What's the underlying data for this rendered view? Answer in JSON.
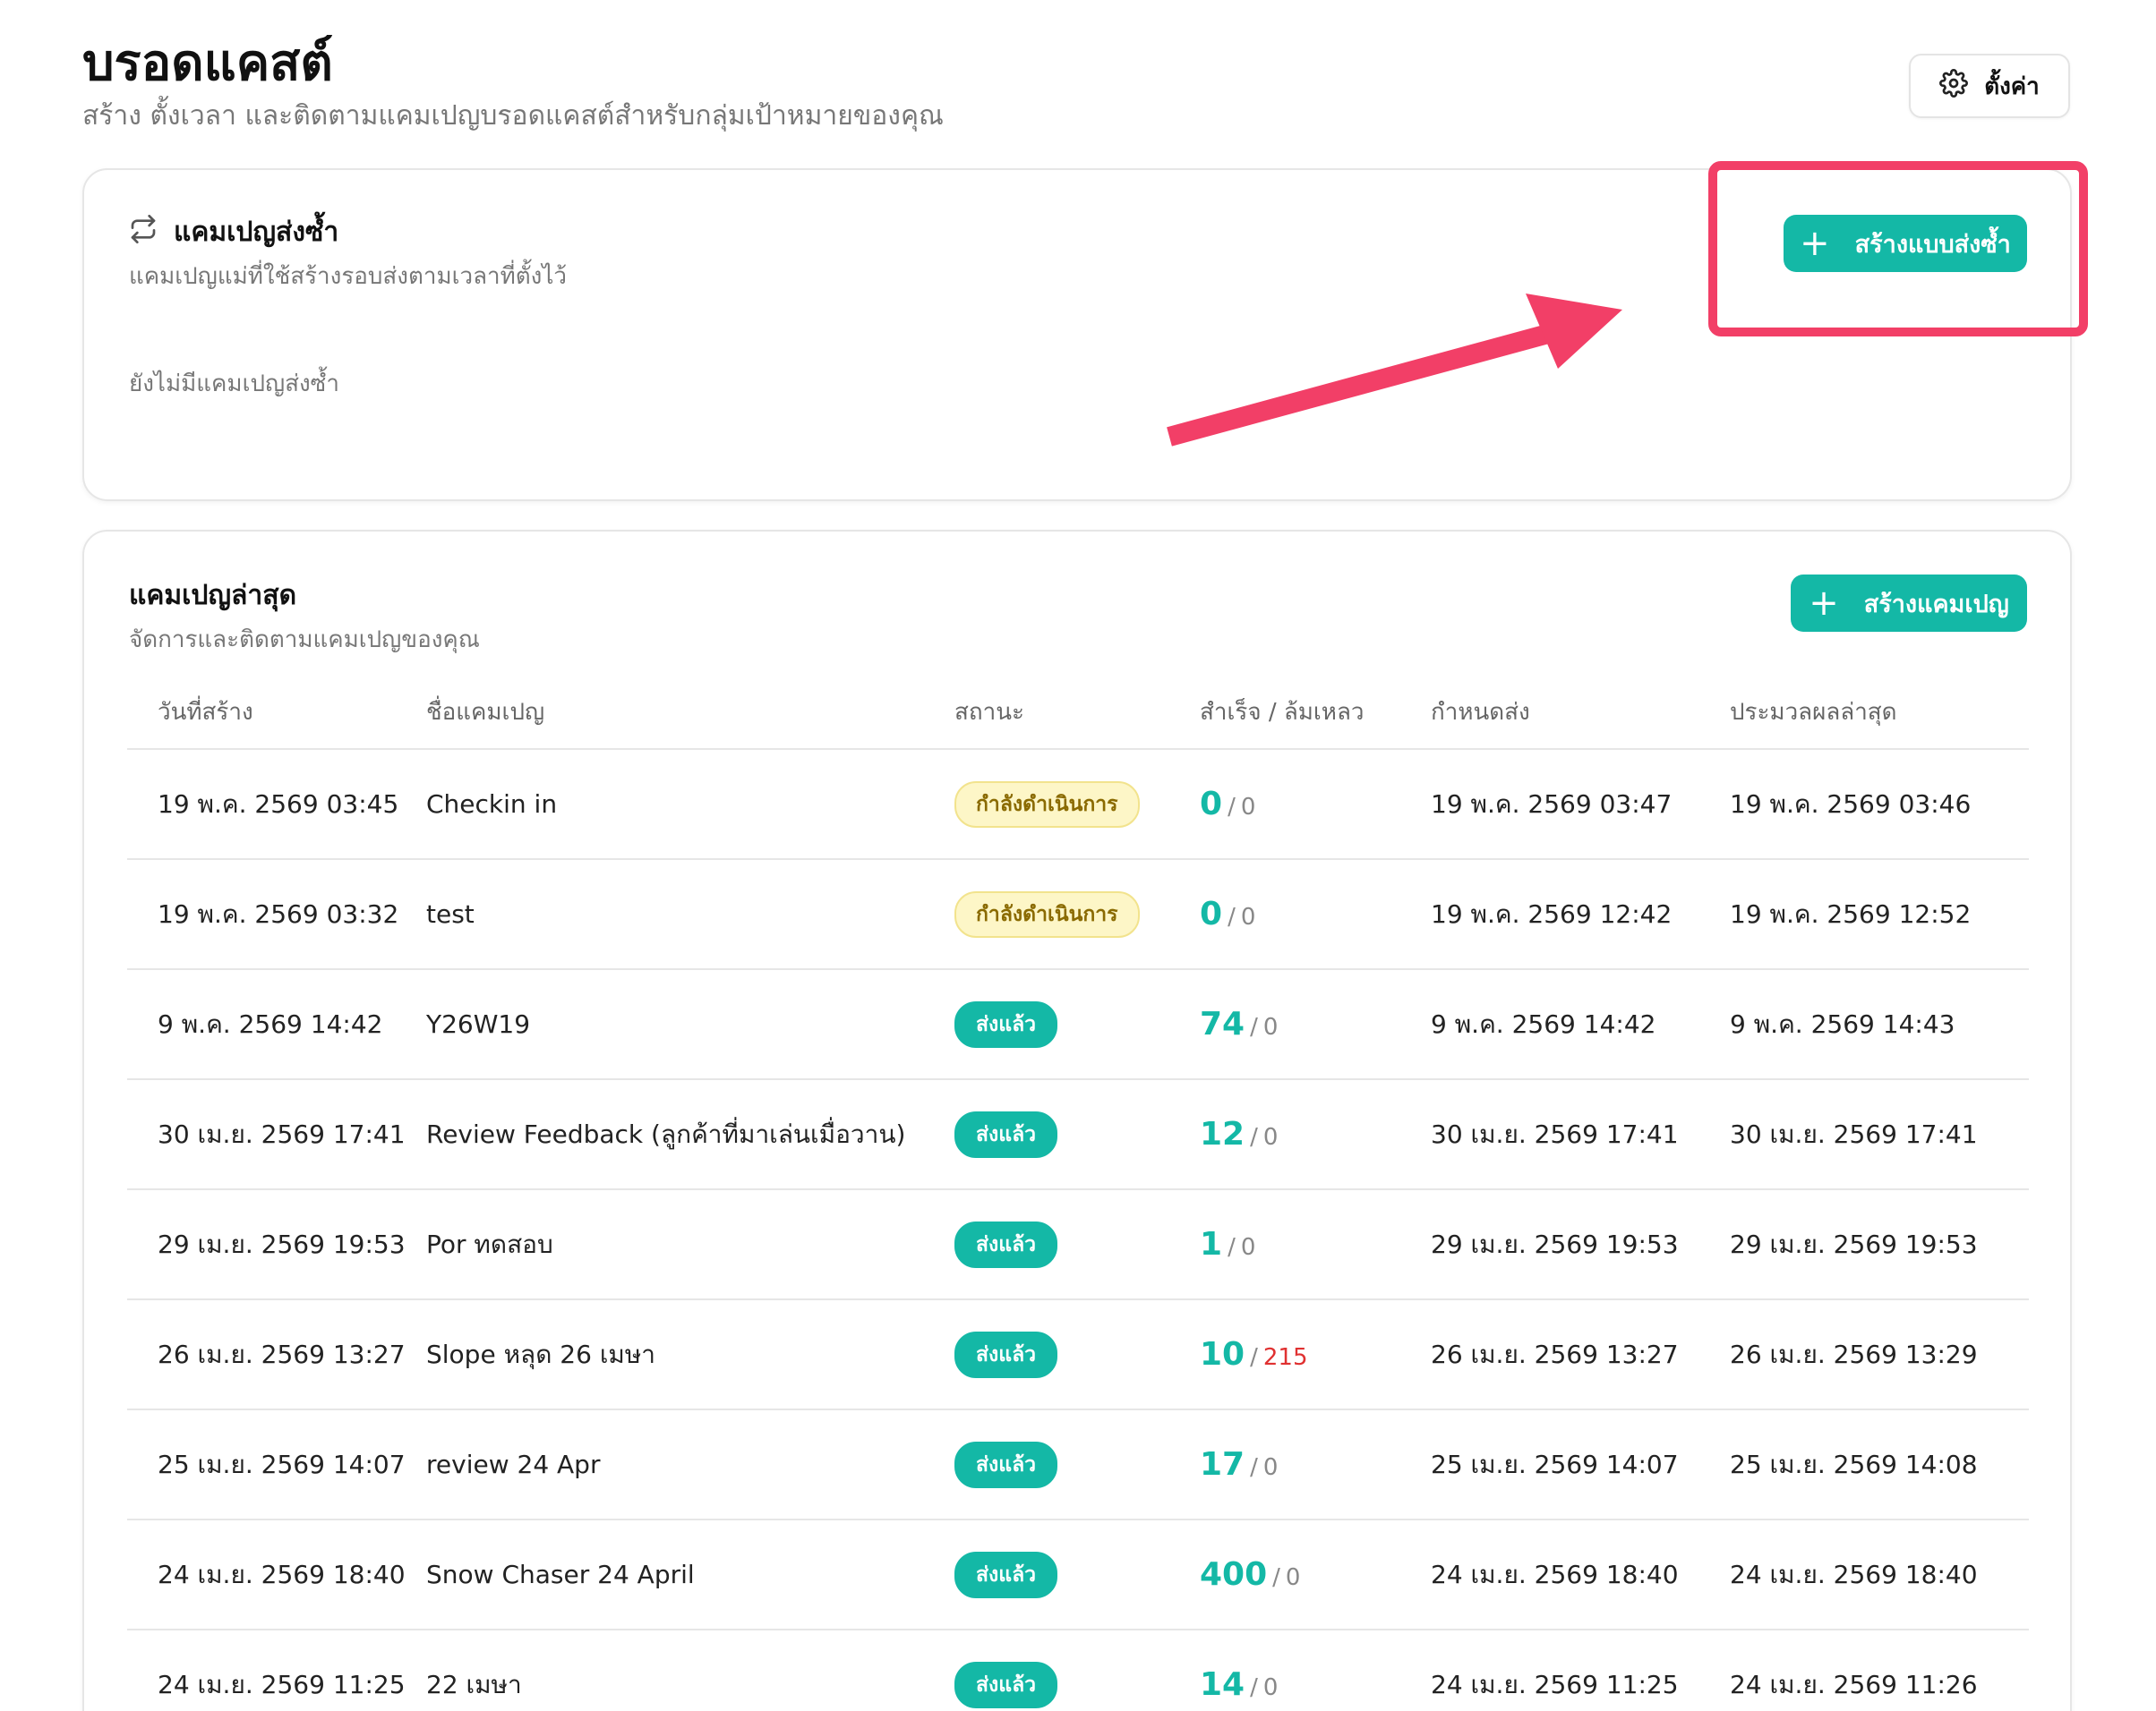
{
  "header": {
    "title": "บรอดแคสต์",
    "subtitle": "สร้าง ตั้งเวลา และติดตามแคมเปญบรอดแคสต์สำหรับกลุ่มเป้าหมายของคุณ",
    "settings_label": "ตั้งค่า",
    "settings_icon": "gear-icon"
  },
  "recurring": {
    "title": "แคมเปญส่งซ้ำ",
    "icon": "repeat-icon",
    "description": "แคมเปญแม่ที่ใช้สร้างรอบส่งตามเวลาที่ตั้งไว้",
    "empty_text": "ยังไม่มีแคมเปญส่งซ้ำ",
    "create_label": "สร้างแบบส่งซ้ำ"
  },
  "latest": {
    "title": "แคมเปญล่าสุด",
    "description": "จัดการและติดตามแคมเปญของคุณ",
    "create_label": "สร้างแคมเปญ",
    "columns": [
      "วันที่สร้าง",
      "ชื่อแคมเปญ",
      "สถานะ",
      "สำเร็จ / ล้มเหลว",
      "กำหนดส่ง",
      "ประมวลผลล่าสุด"
    ],
    "rows": [
      {
        "created": "19 พ.ค. 2569 03:45",
        "name": "Checkin in",
        "status": "กำลังดำเนินการ",
        "status_type": "pending",
        "success": "0",
        "fail": "0",
        "scheduled": "19 พ.ค. 2569 03:47",
        "processed": "19 พ.ค. 2569 03:46"
      },
      {
        "created": "19 พ.ค. 2569 03:32",
        "name": "test",
        "status": "กำลังดำเนินการ",
        "status_type": "pending",
        "success": "0",
        "fail": "0",
        "scheduled": "19 พ.ค. 2569 12:42",
        "processed": "19 พ.ค. 2569 12:52"
      },
      {
        "created": "9 พ.ค. 2569 14:42",
        "name": "Y26W19",
        "status": "ส่งแล้ว",
        "status_type": "sent",
        "success": "74",
        "fail": "0",
        "scheduled": "9 พ.ค. 2569 14:42",
        "processed": "9 พ.ค. 2569 14:43"
      },
      {
        "created": "30 เม.ย. 2569 17:41",
        "name": "Review Feedback (ลูกค้าที่มาเล่นเมื่อวาน)",
        "status": "ส่งแล้ว",
        "status_type": "sent",
        "success": "12",
        "fail": "0",
        "scheduled": "30 เม.ย. 2569 17:41",
        "processed": "30 เม.ย. 2569 17:41"
      },
      {
        "created": "29 เม.ย. 2569 19:53",
        "name": "Por ทดสอบ",
        "status": "ส่งแล้ว",
        "status_type": "sent",
        "success": "1",
        "fail": "0",
        "scheduled": "29 เม.ย. 2569 19:53",
        "processed": "29 เม.ย. 2569 19:53"
      },
      {
        "created": "26 เม.ย. 2569 13:27",
        "name": "Slope หลุด 26 เมษา",
        "status": "ส่งแล้ว",
        "status_type": "sent",
        "success": "10",
        "fail": "215",
        "scheduled": "26 เม.ย. 2569 13:27",
        "processed": "26 เม.ย. 2569 13:29"
      },
      {
        "created": "25 เม.ย. 2569 14:07",
        "name": "review 24 Apr",
        "status": "ส่งแล้ว",
        "status_type": "sent",
        "success": "17",
        "fail": "0",
        "scheduled": "25 เม.ย. 2569 14:07",
        "processed": "25 เม.ย. 2569 14:08"
      },
      {
        "created": "24 เม.ย. 2569 18:40",
        "name": "Snow Chaser 24 April",
        "status": "ส่งแล้ว",
        "status_type": "sent",
        "success": "400",
        "fail": "0",
        "scheduled": "24 เม.ย. 2569 18:40",
        "processed": "24 เม.ย. 2569 18:40"
      },
      {
        "created": "24 เม.ย. 2569 11:25",
        "name": "22 เมษา",
        "status": "ส่งแล้ว",
        "status_type": "sent",
        "success": "14",
        "fail": "0",
        "scheduled": "24 เม.ย. 2569 11:25",
        "processed": "24 เม.ย. 2569 11:26"
      }
    ]
  },
  "annotation": {
    "color": "#f23f67"
  },
  "colors": {
    "accent": "#14b8a6",
    "fail_red": "#e03131",
    "pending_bg": "#fdf6c7"
  }
}
